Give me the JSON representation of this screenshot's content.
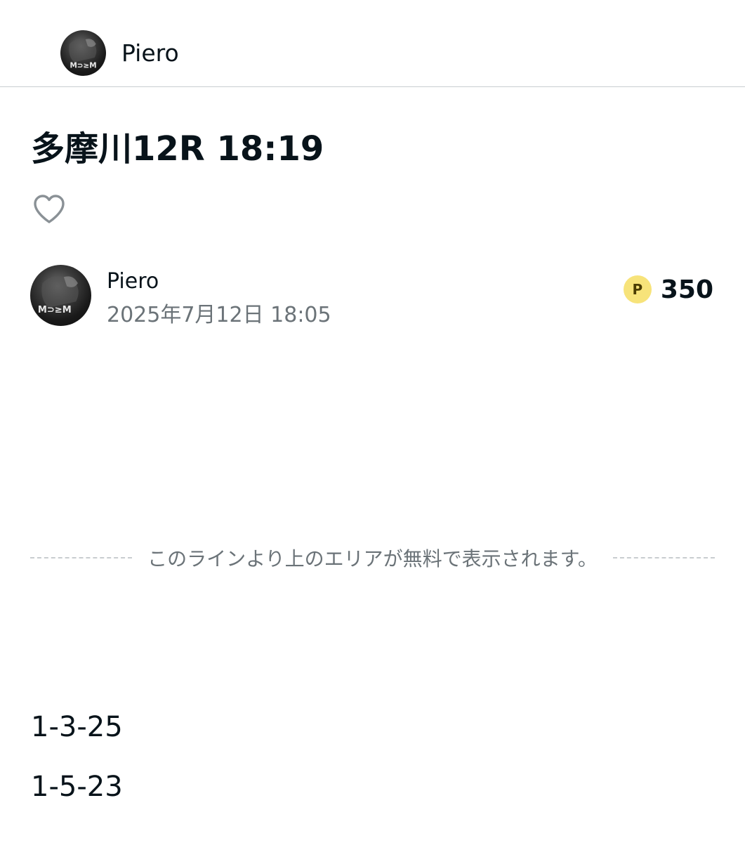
{
  "header": {
    "creator_name": "Piero"
  },
  "article": {
    "title": "多摩川12R 18:19",
    "author_name": "Piero",
    "published": "2025年7月12日 18:05",
    "price_badge": "P",
    "price": "350",
    "paywall_notice": "このラインより上のエリアが無料で表示されます。",
    "body_lines": [
      "1-3-25",
      "1-5-23"
    ]
  },
  "icons": {
    "like": "heart-outline-icon",
    "avatar": "avatar-image"
  },
  "colors": {
    "text": "#08131a",
    "muted": "#6b7378",
    "divider": "#c9cdd0",
    "point_badge": "#f7e37a"
  }
}
